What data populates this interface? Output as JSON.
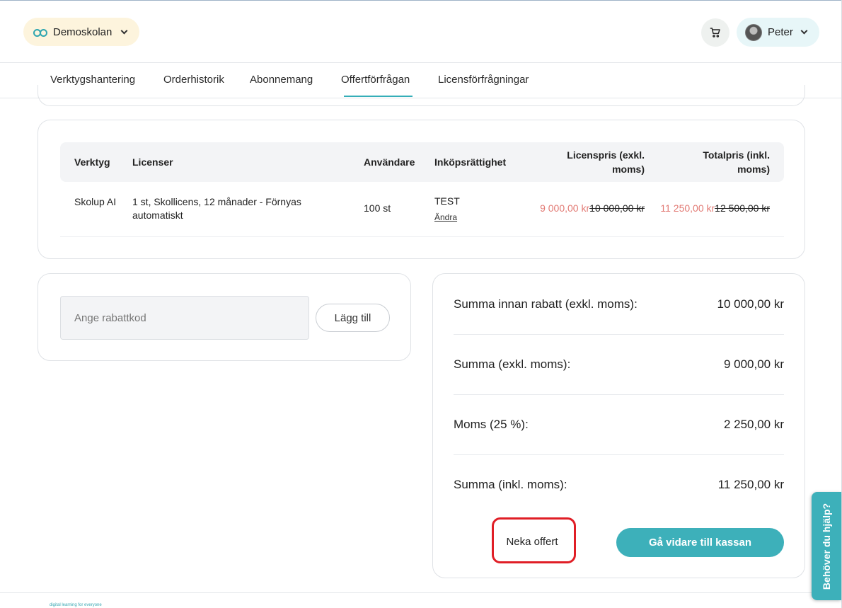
{
  "header": {
    "school_name": "Demoskolan",
    "user_name": "Peter"
  },
  "tabs": [
    {
      "label": "Verktygshantering"
    },
    {
      "label": "Orderhistorik"
    },
    {
      "label": "Abonnemang"
    },
    {
      "label": "Offertförfrågan",
      "active": true
    },
    {
      "label": "Licensförfrågningar"
    }
  ],
  "table": {
    "columns": [
      "Verktyg",
      "Licenser",
      "Användare",
      "Inköpsrättighet",
      "Licenspris (exkl. moms)",
      "Totalpris (inkl. moms)"
    ],
    "rows": [
      {
        "tool": "Skolup AI",
        "licenses": "1 st, Skollicens, 12 månader - Förnyas automatiskt",
        "users": "100 st",
        "purchase_right": "TEST",
        "change_link": "Ändra",
        "license_price": "9 000,00 kr",
        "license_price_original": "10 000,00 kr",
        "total_price": "11 250,00 kr",
        "total_price_original": "12 500,00 kr"
      }
    ]
  },
  "discount": {
    "placeholder": "Ange rabattkod",
    "button_label": "Lägg till"
  },
  "summary": {
    "rows": [
      {
        "label": "Summa innan rabatt (exkl. moms):",
        "value": "10 000,00 kr"
      },
      {
        "label": "Summa (exkl. moms):",
        "value": "9 000,00 kr"
      },
      {
        "label": "Moms (25 %):",
        "value": "2 250,00 kr"
      },
      {
        "label": "Summa (inkl. moms):",
        "value": "11 250,00 kr"
      }
    ],
    "decline_label": "Neka offert",
    "checkout_label": "Gå vidare till kassan"
  },
  "footer": {
    "tagline": "digital learning for everyone"
  },
  "help": {
    "label": "Behöver du hjälp?"
  },
  "colors": {
    "accent": "#3db0ba",
    "discount_price": "#e27a74",
    "highlight": "#e01e26"
  }
}
